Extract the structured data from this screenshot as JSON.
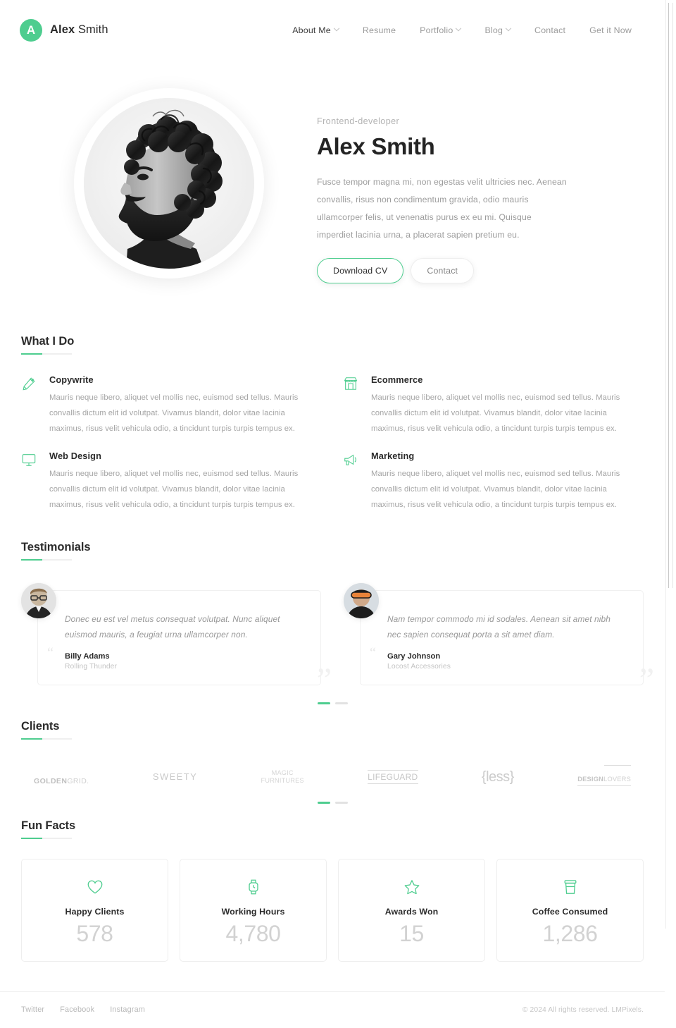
{
  "header": {
    "logo_letter": "A",
    "brand_bold": "Alex",
    "brand_light": " Smith",
    "nav": [
      {
        "label": "About Me",
        "caret": true,
        "active": true
      },
      {
        "label": "Resume",
        "caret": false,
        "active": false
      },
      {
        "label": "Portfolio",
        "caret": true,
        "active": false
      },
      {
        "label": "Blog",
        "caret": true,
        "active": false
      },
      {
        "label": "Contact",
        "caret": false,
        "active": false
      },
      {
        "label": "Get it Now",
        "caret": false,
        "active": false
      }
    ]
  },
  "hero": {
    "role": "Frontend-developer",
    "name": "Alex Smith",
    "description": "Fusce tempor magna mi, non egestas velit ultricies nec. Aenean convallis, risus non condimentum gravida, odio mauris ullamcorper felis, ut venenatis purus ex eu mi. Quisque imperdiet lacinia urna, a placerat sapien pretium eu.",
    "primary_button": "Download CV",
    "secondary_button": "Contact",
    "photo_alt": "black-and-white profile portrait of bearded man with curly hair"
  },
  "what_i_do": {
    "title": "What I Do",
    "items": [
      {
        "icon": "pencil-icon",
        "title": "Copywrite",
        "desc": "Mauris neque libero, aliquet vel mollis nec, euismod sed tellus. Mauris convallis dictum elit id volutpat. Vivamus blandit, dolor vitae lacinia maximus, risus velit vehicula odio, a tincidunt turpis turpis tempus ex."
      },
      {
        "icon": "store-icon",
        "title": "Ecommerce",
        "desc": "Mauris neque libero, aliquet vel mollis nec, euismod sed tellus. Mauris convallis dictum elit id volutpat. Vivamus blandit, dolor vitae lacinia maximus, risus velit vehicula odio, a tincidunt turpis turpis tempus ex."
      },
      {
        "icon": "monitor-icon",
        "title": "Web Design",
        "desc": "Mauris neque libero, aliquet vel mollis nec, euismod sed tellus. Mauris convallis dictum elit id volutpat. Vivamus blandit, dolor vitae lacinia maximus, risus velit vehicula odio, a tincidunt turpis turpis tempus ex."
      },
      {
        "icon": "megaphone-icon",
        "title": "Marketing",
        "desc": "Mauris neque libero, aliquet vel mollis nec, euismod sed tellus. Mauris convallis dictum elit id volutpat. Vivamus blandit, dolor vitae lacinia maximus, risus velit vehicula odio, a tincidunt turpis turpis tempus ex."
      }
    ]
  },
  "testimonials": {
    "title": "Testimonials",
    "items": [
      {
        "quote": "Donec eu est vel metus consequat volutpat. Nunc aliquet euismod mauris, a feugiat urna ullamcorper non.",
        "author": "Billy Adams",
        "company": "Rolling Thunder",
        "mark": "“"
      },
      {
        "quote": "Nam tempor commodo mi id sodales. Aenean sit amet nibh nec sapien consequat porta a sit amet diam.",
        "author": "Gary Johnson",
        "company": "Locost Accessories",
        "mark": "“"
      }
    ],
    "dots": [
      {
        "active": true
      },
      {
        "active": false
      }
    ]
  },
  "clients": {
    "title": "Clients",
    "logos": [
      {
        "name": "GOLDENGRID.",
        "bold": "GOLDEN",
        "light": "GRID.",
        "style": "goldengrid"
      },
      {
        "name": "SWEETY",
        "style": "sweety"
      },
      {
        "name": "MAGIC\nFURNITURES",
        "style": "magic"
      },
      {
        "name": "LIFEGUARD",
        "style": "lifeguard"
      },
      {
        "name": "{less}",
        "style": "less"
      },
      {
        "name": "DESIGNLOVERS",
        "bold": "DESIGN",
        "light": "LOVERS",
        "style": "designlovers"
      }
    ],
    "dots": [
      {
        "active": true
      },
      {
        "active": false
      }
    ]
  },
  "fun_facts": {
    "title": "Fun Facts",
    "items": [
      {
        "icon": "heart-icon",
        "label": "Happy Clients",
        "value": "578"
      },
      {
        "icon": "watch-icon",
        "label": "Working Hours",
        "value": "4,780"
      },
      {
        "icon": "star-icon",
        "label": "Awards Won",
        "value": "15"
      },
      {
        "icon": "coffee-cup-icon",
        "label": "Coffee Consumed",
        "value": "1,286"
      }
    ]
  },
  "footer": {
    "social": [
      "Twitter",
      "Facebook",
      "Instagram"
    ],
    "copyright": "© 2024 All rights reserved. LMPixels."
  },
  "colors": {
    "accent": "#4ECD8F",
    "text_dark": "#2b2b2b",
    "text_muted": "#a5a5a5",
    "border": "#eeeeee"
  }
}
